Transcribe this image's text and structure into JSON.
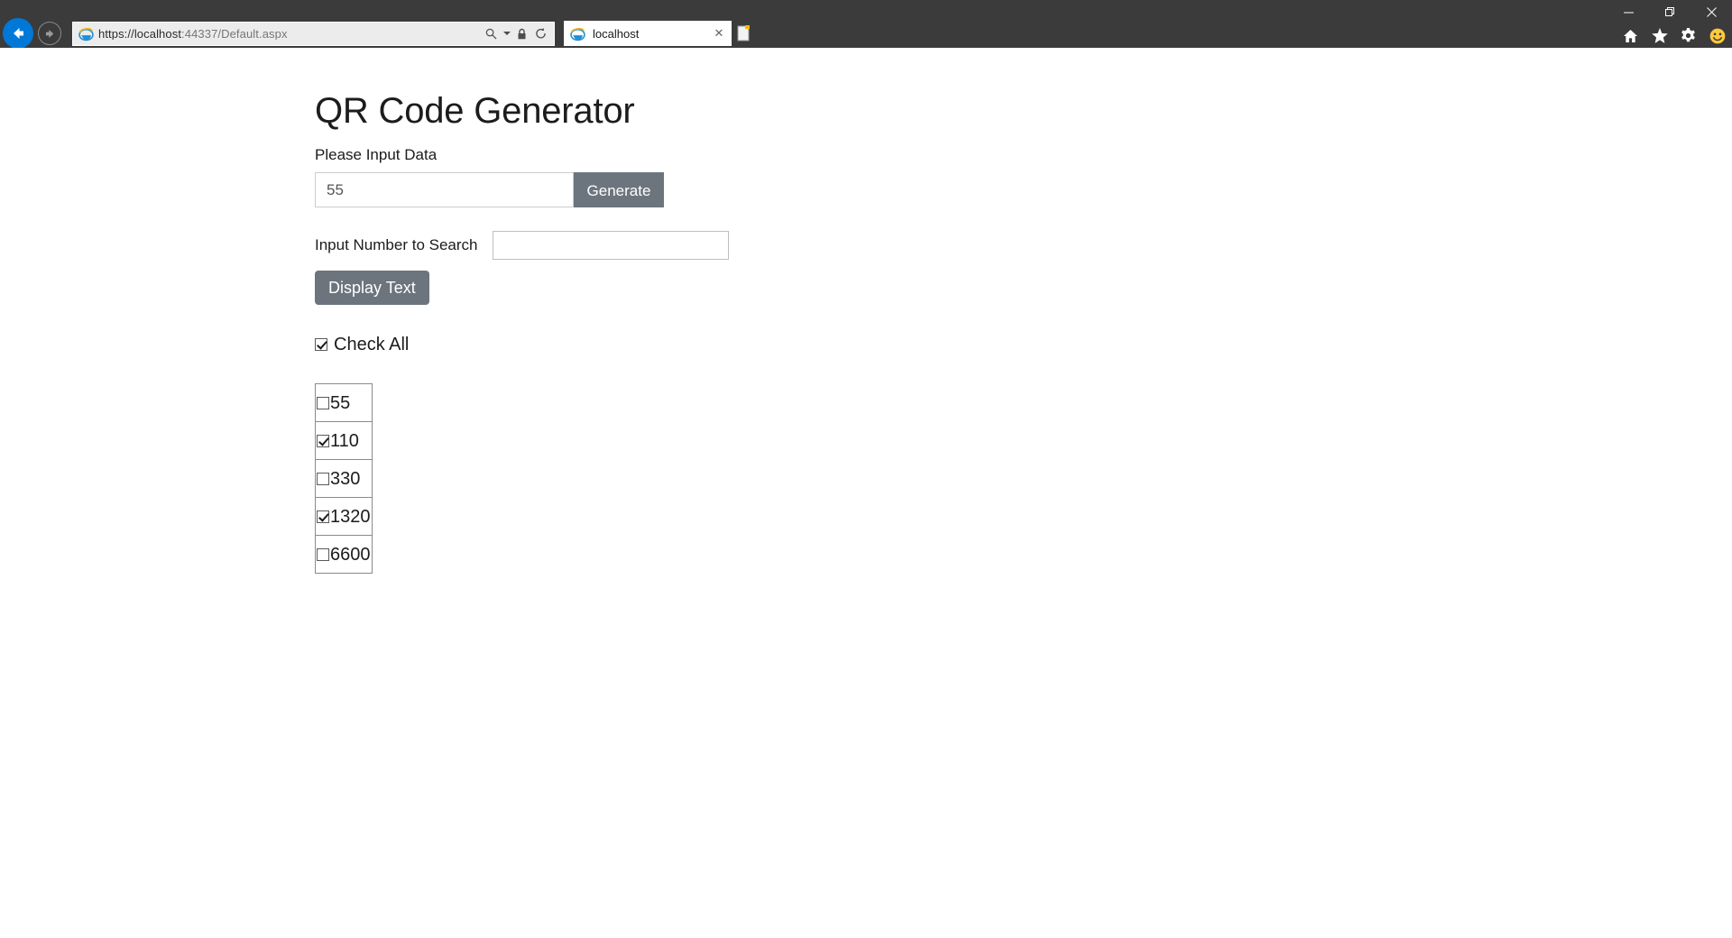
{
  "browser": {
    "window_controls": {
      "minimize": "—",
      "restore": "❐",
      "close": "✕"
    },
    "back_icon": "back-arrow-icon",
    "forward_icon": "forward-arrow-icon",
    "address": {
      "scheme_host": "https://localhost",
      "path": ":44337/Default.aspx",
      "full_url": "https://localhost:44337/Default.aspx",
      "search_icon": "search-icon",
      "dropdown_caret": "▾",
      "lock_icon": "lock-icon",
      "refresh_icon": "refresh-icon"
    },
    "tab": {
      "title": "localhost",
      "close_label": "✕",
      "favicon": "internet-explorer-icon"
    },
    "new_tab_label": "new-tab-icon",
    "toolbar_icons": [
      "home-icon",
      "favorites-star-icon",
      "settings-gear-icon",
      "smiley-feedback-icon"
    ]
  },
  "page": {
    "title": "QR Code Generator",
    "input_data_label": "Please Input Data",
    "input_data_value": "55",
    "input_data_placeholder": "",
    "generate_button": "Generate",
    "search_label": "Input Number to Search",
    "search_value": "",
    "search_placeholder": "",
    "display_text_button": "Display Text",
    "check_all_label": "Check All",
    "check_all_checked": true,
    "items": [
      {
        "label": "55",
        "checked": false
      },
      {
        "label": "110",
        "checked": true
      },
      {
        "label": "330",
        "checked": false
      },
      {
        "label": "1320",
        "checked": true
      },
      {
        "label": "6600",
        "checked": false
      }
    ]
  },
  "colors": {
    "chrome_bg": "#3b3b3b",
    "accent_blue": "#0078d7",
    "button_gray": "#6c757d",
    "page_bg": "#ffffff",
    "text": "#1c1c1c"
  }
}
